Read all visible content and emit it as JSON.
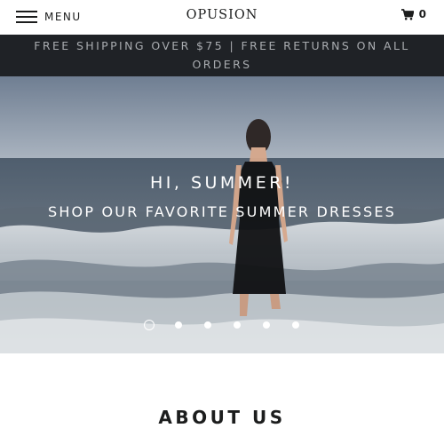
{
  "header": {
    "menu_label": "MENU",
    "logo_text": "OPUSION",
    "cart_count": "0",
    "menu_icon": "hamburger-icon",
    "cart_icon": "cart-icon"
  },
  "announcement": {
    "text": "FREE SHIPPING OVER $75 | FREE RETURNS ON ALL ORDERS"
  },
  "hero": {
    "title": "HI, SUMMER!",
    "subtitle": "SHOP OUR FAVORITE SUMMER DRESSES",
    "slide_count": 6,
    "active_slide": 1
  },
  "about": {
    "title": "ABOUT US"
  },
  "colors": {
    "announcement_bg": "#1f2226",
    "announcement_text": "#a9acb0",
    "text_dark": "#1c1d1d"
  }
}
